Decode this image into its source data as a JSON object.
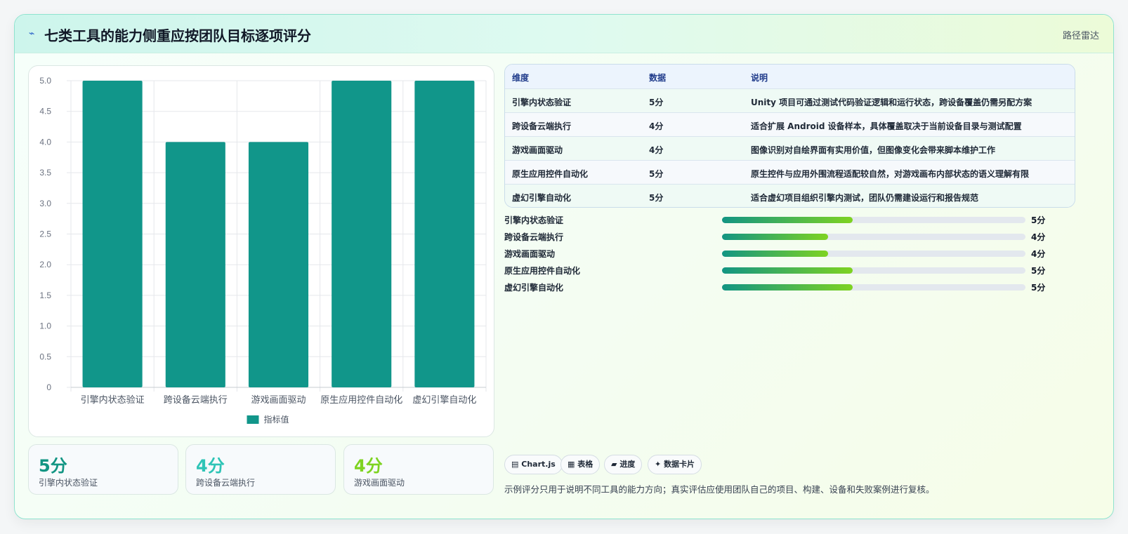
{
  "header": {
    "icon": "zap-icon",
    "title": "七类工具的能力侧重应按团队目标逐项评分",
    "right_label": "路径雷达"
  },
  "colors": {
    "bar": "#11968a",
    "teal": "#129583",
    "cyan": "#2ec4b6",
    "lime": "#7ed321"
  },
  "chart_data": {
    "type": "bar",
    "categories": [
      "引擎内状态验证",
      "跨设备云端执行",
      "游戏画面驱动",
      "原生应用控件自动化",
      "虚幻引擎自动化"
    ],
    "series": [
      {
        "name": "指标值",
        "values": [
          5,
          4,
          4,
          5,
          5
        ]
      }
    ],
    "ylim": [
      0,
      5
    ],
    "yticks": [
      "0",
      "0.5",
      "1.0",
      "1.5",
      "2.0",
      "2.5",
      "3.0",
      "3.5",
      "4.0",
      "4.5",
      "5.0"
    ],
    "grid": true,
    "legend": "bottom"
  },
  "stats": [
    {
      "value": "5分",
      "label": "引擎内状态验证"
    },
    {
      "value": "4分",
      "label": "跨设备云端执行"
    },
    {
      "value": "4分",
      "label": "游戏画面驱动"
    }
  ],
  "table": {
    "headers": [
      "维度",
      "数据",
      "说明"
    ],
    "rows": [
      [
        "引擎内状态验证",
        "5分",
        "Unity 项目可通过测试代码验证逻辑和运行状态，跨设备覆盖仍需另配方案"
      ],
      [
        "跨设备云端执行",
        "4分",
        "适合扩展 Android 设备样本，具体覆盖取决于当前设备目录与测试配置"
      ],
      [
        "游戏画面驱动",
        "4分",
        "图像识别对自绘界面有实用价值，但图像变化会带来脚本维护工作"
      ],
      [
        "原生应用控件自动化",
        "5分",
        "原生控件与应用外围流程适配较自然，对游戏画布内部状态的语义理解有限"
      ],
      [
        "虚幻引擎自动化",
        "5分",
        "适合虚幻项目组织引擎内测试，团队仍需建设运行和报告规范"
      ]
    ]
  },
  "progress": [
    {
      "label": "引擎内状态验证",
      "value": "5分",
      "fraction": 0.43
    },
    {
      "label": "跨设备云端执行",
      "value": "4分",
      "fraction": 0.35
    },
    {
      "label": "游戏画面驱动",
      "value": "4分",
      "fraction": 0.35
    },
    {
      "label": "原生应用控件自动化",
      "value": "5分",
      "fraction": 0.43
    },
    {
      "label": "虚幻引擎自动化",
      "value": "5分",
      "fraction": 0.43
    }
  ],
  "tags": [
    {
      "icon": "chart-icon",
      "glyph": "▤",
      "label": "Chart.js"
    },
    {
      "icon": "table-icon",
      "glyph": "▦",
      "label": "表格"
    },
    {
      "icon": "progress-icon",
      "glyph": "▰",
      "label": "进度"
    },
    {
      "icon": "sparkle-icon",
      "glyph": "✦",
      "label": "数据卡片"
    }
  ],
  "note": "示例评分只用于说明不同工具的能力方向；真实评估应使用团队自己的项目、构建、设备和失败案例进行复核。"
}
